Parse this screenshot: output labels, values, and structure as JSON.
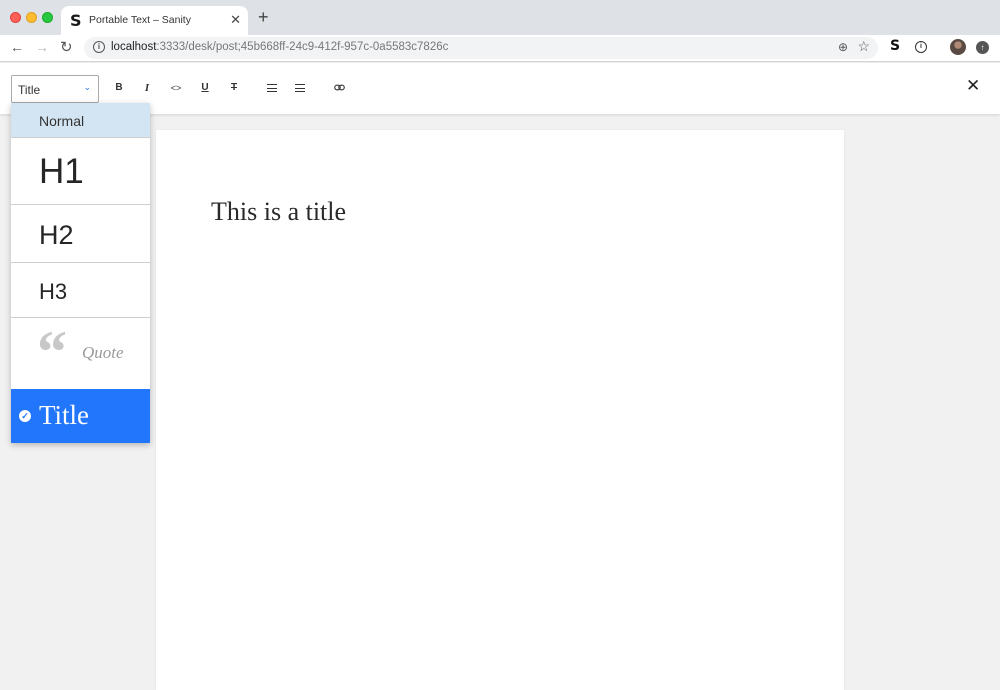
{
  "browser": {
    "tab_favicon": "S",
    "tab_title": "Portable Text – Sanity",
    "tab_close": "✕",
    "new_tab": "+",
    "url_host": "localhost",
    "url_path": ":3333/desk/post;45b668ff-24c9-412f-957c-0a5583c7826c",
    "extension_label": "S"
  },
  "toolbar": {
    "style_select_value": "Title",
    "bold_label": "B",
    "italic_label": "I",
    "code_label": "<>",
    "underline_label": "U",
    "strike_label": "T",
    "close_label": "✕"
  },
  "style_menu": {
    "items": [
      {
        "label": "Normal",
        "state": "hovered"
      },
      {
        "label": "H1"
      },
      {
        "label": "H2"
      },
      {
        "label": "H3"
      },
      {
        "label": "Quote"
      },
      {
        "label": "Title",
        "state": "selected"
      }
    ]
  },
  "document": {
    "title_text": "This is a title"
  },
  "colors": {
    "accent": "#2276fc",
    "hover": "#d3e5f2"
  }
}
